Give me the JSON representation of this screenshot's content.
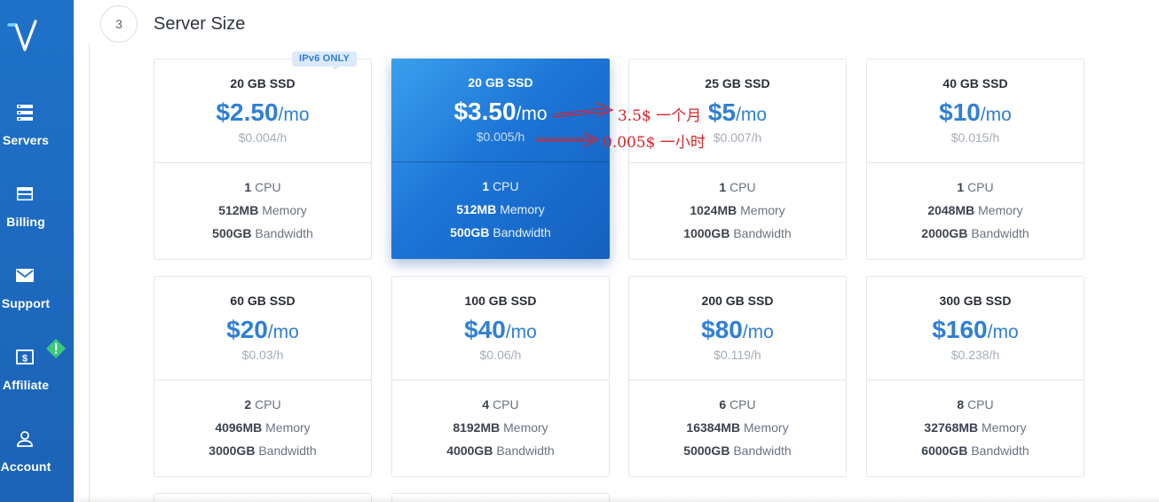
{
  "sidebar": {
    "items": [
      {
        "label": "Servers",
        "icon": "servers-icon"
      },
      {
        "label": "Billing",
        "icon": "card-icon"
      },
      {
        "label": "Support",
        "icon": "mail-icon"
      },
      {
        "label": "Affiliate",
        "icon": "dollar-icon"
      },
      {
        "label": "Account",
        "icon": "user-icon"
      }
    ]
  },
  "section": {
    "step": "3",
    "title": "Server Size"
  },
  "badge": "IPv6 ONLY",
  "plans": [
    {
      "storage": "20 GB SSD",
      "price": "$2.50",
      "per": "/mo",
      "hourly": "$0.004/h",
      "cpu": "1",
      "cpu_label": "CPU",
      "memory": "512MB",
      "memory_label": "Memory",
      "bandwidth": "500GB",
      "bandwidth_label": "Bandwidth",
      "selected": false
    },
    {
      "storage": "20 GB SSD",
      "price": "$3.50",
      "per": "/mo",
      "hourly": "$0.005/h",
      "cpu": "1",
      "cpu_label": "CPU",
      "memory": "512MB",
      "memory_label": "Memory",
      "bandwidth": "500GB",
      "bandwidth_label": "Bandwidth",
      "selected": true
    },
    {
      "storage": "25 GB SSD",
      "price": "$5",
      "per": "/mo",
      "hourly": "$0.007/h",
      "cpu": "1",
      "cpu_label": "CPU",
      "memory": "1024MB",
      "memory_label": "Memory",
      "bandwidth": "1000GB",
      "bandwidth_label": "Bandwidth",
      "selected": false
    },
    {
      "storage": "40 GB SSD",
      "price": "$10",
      "per": "/mo",
      "hourly": "$0.015/h",
      "cpu": "1",
      "cpu_label": "CPU",
      "memory": "2048MB",
      "memory_label": "Memory",
      "bandwidth": "2000GB",
      "bandwidth_label": "Bandwidth",
      "selected": false
    },
    {
      "storage": "60 GB SSD",
      "price": "$20",
      "per": "/mo",
      "hourly": "$0.03/h",
      "cpu": "2",
      "cpu_label": "CPU",
      "memory": "4096MB",
      "memory_label": "Memory",
      "bandwidth": "3000GB",
      "bandwidth_label": "Bandwidth",
      "selected": false
    },
    {
      "storage": "100 GB SSD",
      "price": "$40",
      "per": "/mo",
      "hourly": "$0.06/h",
      "cpu": "4",
      "cpu_label": "CPU",
      "memory": "8192MB",
      "memory_label": "Memory",
      "bandwidth": "4000GB",
      "bandwidth_label": "Bandwidth",
      "selected": false
    },
    {
      "storage": "200 GB SSD",
      "price": "$80",
      "per": "/mo",
      "hourly": "$0.119/h",
      "cpu": "6",
      "cpu_label": "CPU",
      "memory": "16384MB",
      "memory_label": "Memory",
      "bandwidth": "5000GB",
      "bandwidth_label": "Bandwidth",
      "selected": false
    },
    {
      "storage": "300 GB SSD",
      "price": "$160",
      "per": "/mo",
      "hourly": "$0.238/h",
      "cpu": "8",
      "cpu_label": "CPU",
      "memory": "32768MB",
      "memory_label": "Memory",
      "bandwidth": "6000GB",
      "bandwidth_label": "Bandwidth",
      "selected": false
    }
  ],
  "annotations": {
    "monthly": "3.5$ 一个月",
    "hourly": "0.005$ 一小时"
  },
  "colors": {
    "sidebar": "#1f71c9",
    "accent": "#2f7fd4",
    "annotation": "#d8232a"
  }
}
